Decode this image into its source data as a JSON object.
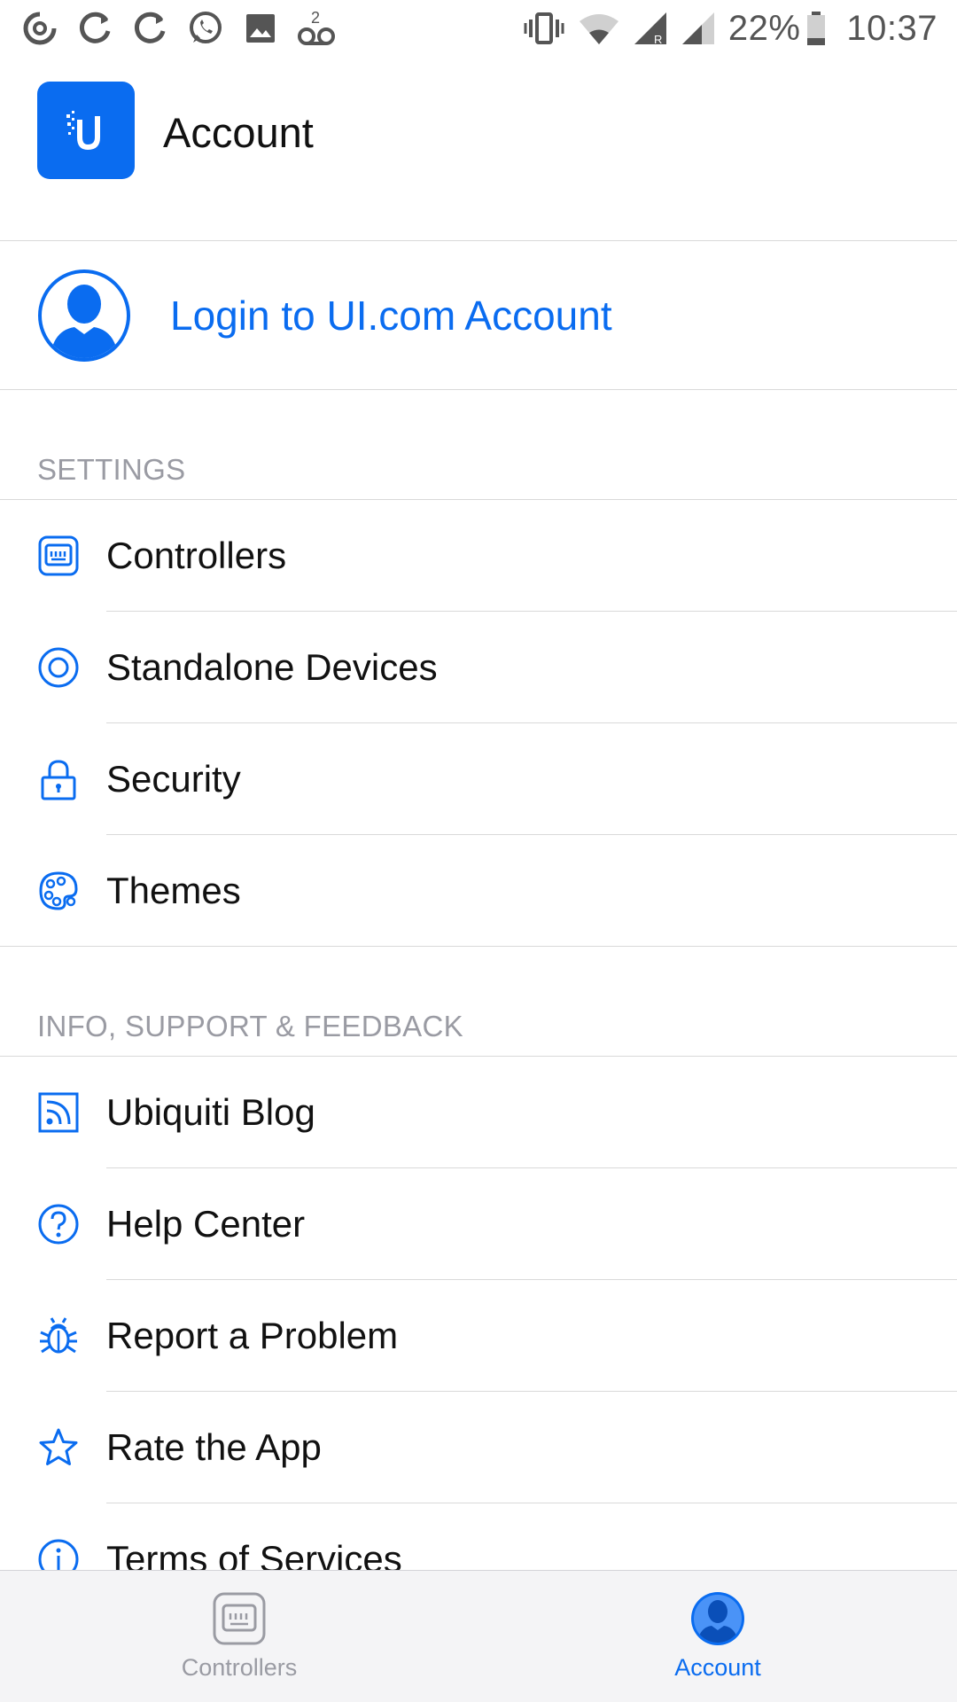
{
  "status_bar": {
    "battery": "22%",
    "time": "10:37",
    "notification_count": "2"
  },
  "header": {
    "title": "Account"
  },
  "login": {
    "label": "Login to UI.com Account"
  },
  "settings": {
    "header": "SETTINGS",
    "items": [
      {
        "label": "Controllers",
        "icon": "controller-icon"
      },
      {
        "label": "Standalone Devices",
        "icon": "device-icon"
      },
      {
        "label": "Security",
        "icon": "lock-icon"
      },
      {
        "label": "Themes",
        "icon": "palette-icon"
      }
    ]
  },
  "info": {
    "header": "INFO, SUPPORT & FEEDBACK",
    "items": [
      {
        "label": "Ubiquiti Blog",
        "icon": "rss-icon"
      },
      {
        "label": "Help Center",
        "icon": "help-icon"
      },
      {
        "label": "Report a Problem",
        "icon": "bug-icon"
      },
      {
        "label": "Rate the App",
        "icon": "star-icon"
      },
      {
        "label": "Terms of Services",
        "icon": "info-icon"
      }
    ]
  },
  "tabs": [
    {
      "label": "Controllers",
      "active": false
    },
    {
      "label": "Account",
      "active": true
    }
  ],
  "colors": {
    "accent": "#0a6cf0",
    "muted": "#9a9ba3",
    "divider": "#d9d9d9",
    "tabbar_bg": "#f4f4f6"
  }
}
